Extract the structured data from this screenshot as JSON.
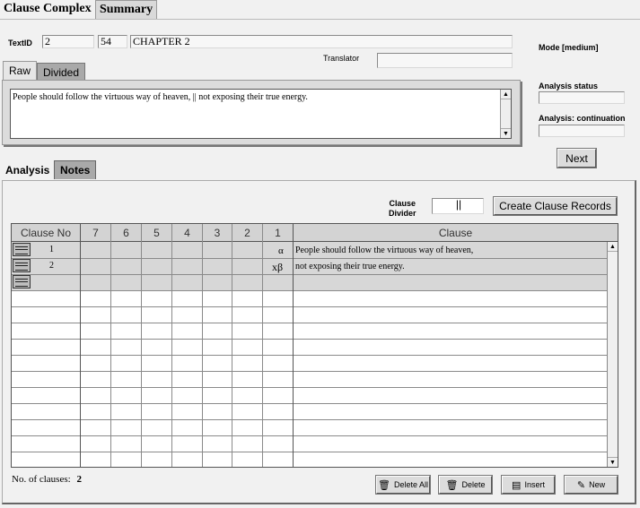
{
  "top_tabs": [
    "Clause Complex",
    "Summary"
  ],
  "header": {
    "textid_label": "TextID",
    "textid_value": "2",
    "number_value": "54",
    "chapter_value": "CHAPTER 2",
    "translator_label": "Translator",
    "translator_value": ""
  },
  "side": {
    "mode_label": "Mode [medium]",
    "analysis_status_label": "Analysis status",
    "analysis_status_value": "",
    "continuation_label": "Analysis: continuation",
    "continuation_value": "",
    "next_label": "Next"
  },
  "text_tabs": [
    "Raw",
    "Divided"
  ],
  "raw_text": "People should follow the virtuous way of heaven, || not exposing their true energy.",
  "analysis_tabs": [
    "Analysis",
    "Notes"
  ],
  "divider": {
    "label_line1": "Clause",
    "label_line2": "Divider",
    "value": "||",
    "create_label": "Create Clause Records"
  },
  "grid": {
    "headers": [
      "Clause No",
      "7",
      "6",
      "5",
      "4",
      "3",
      "2",
      "1",
      "Clause"
    ],
    "rows": [
      {
        "no": "1",
        "level1": "α",
        "clause": "People should follow the virtuous way of heaven,"
      },
      {
        "no": "2",
        "level1": "xβ",
        "clause": "not exposing their true energy."
      },
      {
        "no": "",
        "level1": "",
        "clause": ""
      }
    ]
  },
  "footer": {
    "count_label": "No. of clauses:",
    "count_value": "2",
    "delete_all_label": "Delete All",
    "delete_label": "Delete",
    "insert_label": "Insert",
    "new_label": "New"
  },
  "icons": [
    "trash-icon",
    "insert-icon",
    "new-icon",
    "scroll-up-icon",
    "scroll-down-icon",
    "row-selector-icon"
  ]
}
